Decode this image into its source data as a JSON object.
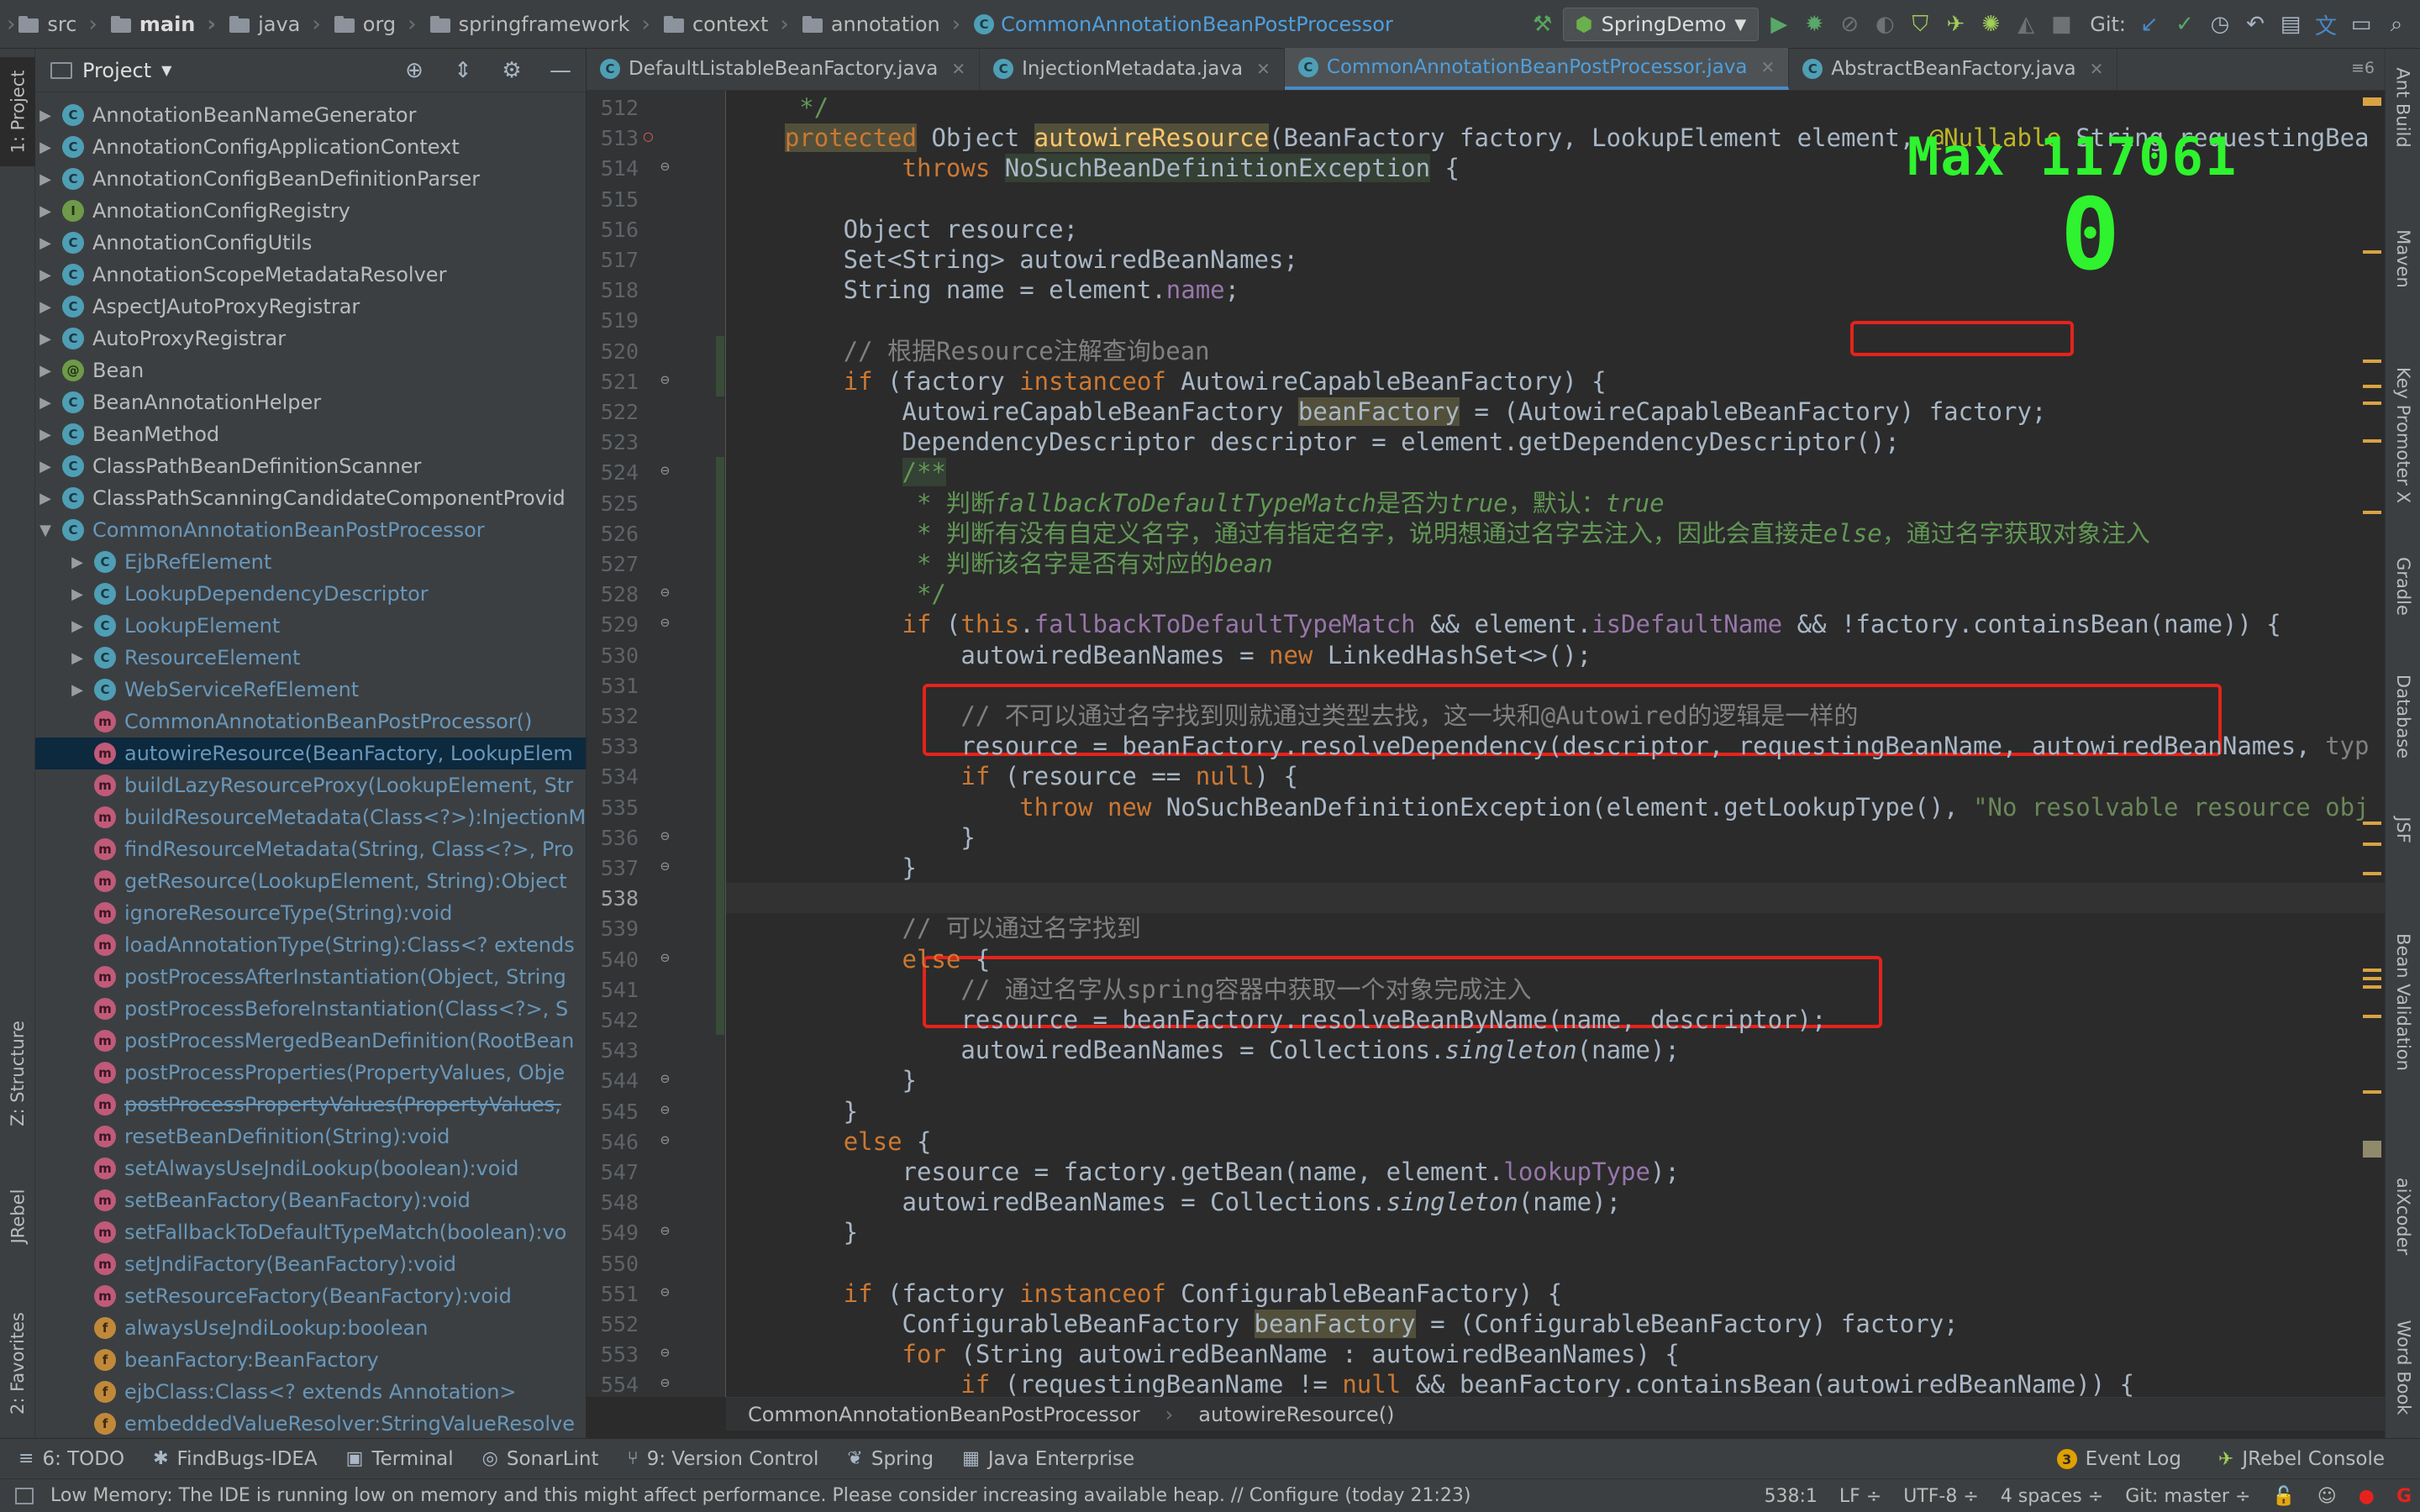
{
  "navbar": {
    "crumbs": [
      {
        "label": "src",
        "icon": "folder-icon"
      },
      {
        "label": "main",
        "icon": "folder-icon",
        "bold": true
      },
      {
        "label": "java",
        "icon": "folder-icon"
      },
      {
        "label": "org",
        "icon": "folder-icon"
      },
      {
        "label": "springframework",
        "icon": "folder-icon"
      },
      {
        "label": "context",
        "icon": "folder-icon"
      },
      {
        "label": "annotation",
        "icon": "folder-icon"
      },
      {
        "label": "CommonAnnotationBeanPostProcessor",
        "icon": "class-icon"
      }
    ],
    "run_config": "SpringDemo",
    "git_label": "Git:"
  },
  "left_stripe": {
    "project_tab": "1: Project",
    "structure_tab": "Z: Structure",
    "jrebel_tab": "JRebel",
    "favorites_tab": "2: Favorites"
  },
  "project_panel": {
    "title": "Project",
    "tree": [
      {
        "label": "AnnotationBeanNameGenerator",
        "icon": "c",
        "depth": 0,
        "arrow": "▶"
      },
      {
        "label": "AnnotationConfigApplicationContext",
        "icon": "c",
        "depth": 0,
        "arrow": "▶"
      },
      {
        "label": "AnnotationConfigBeanDefinitionParser",
        "icon": "c",
        "depth": 0,
        "arrow": "▶"
      },
      {
        "label": "AnnotationConfigRegistry",
        "icon": "i",
        "depth": 0,
        "arrow": "▶"
      },
      {
        "label": "AnnotationConfigUtils",
        "icon": "c",
        "depth": 0,
        "arrow": "▶"
      },
      {
        "label": "AnnotationScopeMetadataResolver",
        "icon": "c",
        "depth": 0,
        "arrow": "▶"
      },
      {
        "label": "AspectJAutoProxyRegistrar",
        "icon": "c",
        "depth": 0,
        "arrow": "▶"
      },
      {
        "label": "AutoProxyRegistrar",
        "icon": "c",
        "depth": 0,
        "arrow": "▶"
      },
      {
        "label": "Bean",
        "icon": "a",
        "depth": 0,
        "arrow": "▶"
      },
      {
        "label": "BeanAnnotationHelper",
        "icon": "c",
        "depth": 0,
        "arrow": "▶"
      },
      {
        "label": "BeanMethod",
        "icon": "c",
        "depth": 0,
        "arrow": "▶"
      },
      {
        "label": "ClassPathBeanDefinitionScanner",
        "icon": "c",
        "depth": 0,
        "arrow": "▶"
      },
      {
        "label": "ClassPathScanningCandidateComponentProvid",
        "icon": "c",
        "depth": 0,
        "arrow": "▶"
      },
      {
        "label": "CommonAnnotationBeanPostProcessor",
        "icon": "c",
        "depth": 0,
        "arrow": "▼",
        "blue": true
      },
      {
        "label": "EjbRefElement",
        "icon": "c",
        "depth": 1,
        "arrow": "▶",
        "blue": true
      },
      {
        "label": "LookupDependencyDescriptor",
        "icon": "c",
        "depth": 1,
        "arrow": "▶",
        "blue": true
      },
      {
        "label": "LookupElement",
        "icon": "c",
        "depth": 1,
        "arrow": "▶",
        "blue": true
      },
      {
        "label": "ResourceElement",
        "icon": "c",
        "depth": 1,
        "arrow": "▶",
        "blue": true
      },
      {
        "label": "WebServiceRefElement",
        "icon": "c",
        "depth": 1,
        "arrow": "▶",
        "blue": true
      },
      {
        "label": "CommonAnnotationBeanPostProcessor()",
        "icon": "m",
        "depth": 1,
        "arrow": "",
        "blue": true
      },
      {
        "label": "autowireResource(BeanFactory, LookupElem",
        "icon": "m",
        "depth": 1,
        "arrow": "",
        "blue": true,
        "selected": true
      },
      {
        "label": "buildLazyResourceProxy(LookupElement, Str",
        "icon": "m",
        "depth": 1,
        "arrow": "",
        "blue": true
      },
      {
        "label": "buildResourceMetadata(Class<?>):InjectionM",
        "icon": "m",
        "depth": 1,
        "arrow": "",
        "blue": true
      },
      {
        "label": "findResourceMetadata(String, Class<?>, Pro",
        "icon": "m",
        "depth": 1,
        "arrow": "",
        "blue": true
      },
      {
        "label": "getResource(LookupElement, String):Object",
        "icon": "m",
        "depth": 1,
        "arrow": "",
        "blue": true
      },
      {
        "label": "ignoreResourceType(String):void",
        "icon": "m",
        "depth": 1,
        "arrow": "",
        "blue": true
      },
      {
        "label": "loadAnnotationType(String):Class<? extends",
        "icon": "m",
        "depth": 1,
        "arrow": "",
        "blue": true
      },
      {
        "label": "postProcessAfterInstantiation(Object, String",
        "icon": "m",
        "depth": 1,
        "arrow": "",
        "blue": true
      },
      {
        "label": "postProcessBeforeInstantiation(Class<?>, S",
        "icon": "m",
        "depth": 1,
        "arrow": "",
        "blue": true
      },
      {
        "label": "postProcessMergedBeanDefinition(RootBean",
        "icon": "m",
        "depth": 1,
        "arrow": "",
        "blue": true
      },
      {
        "label": "postProcessProperties(PropertyValues, Obje",
        "icon": "m",
        "depth": 1,
        "arrow": "",
        "blue": true
      },
      {
        "label": "postProcessPropertyValues(PropertyValues,",
        "icon": "m",
        "depth": 1,
        "arrow": "",
        "blue": true,
        "strike": true
      },
      {
        "label": "resetBeanDefinition(String):void",
        "icon": "m",
        "depth": 1,
        "arrow": "",
        "blue": true
      },
      {
        "label": "setAlwaysUseJndiLookup(boolean):void",
        "icon": "m",
        "depth": 1,
        "arrow": "",
        "blue": true
      },
      {
        "label": "setBeanFactory(BeanFactory):void",
        "icon": "m",
        "depth": 1,
        "arrow": "",
        "blue": true
      },
      {
        "label": "setFallbackToDefaultTypeMatch(boolean):vo",
        "icon": "m",
        "depth": 1,
        "arrow": "",
        "blue": true
      },
      {
        "label": "setJndiFactory(BeanFactory):void",
        "icon": "m",
        "depth": 1,
        "arrow": "",
        "blue": true
      },
      {
        "label": "setResourceFactory(BeanFactory):void",
        "icon": "m",
        "depth": 1,
        "arrow": "",
        "blue": true
      },
      {
        "label": "alwaysUseJndiLookup:boolean",
        "icon": "f",
        "depth": 1,
        "arrow": "",
        "blue": true
      },
      {
        "label": "beanFactory:BeanFactory",
        "icon": "f",
        "depth": 1,
        "arrow": "",
        "blue": true
      },
      {
        "label": "ejbClass:Class<? extends Annotation>",
        "icon": "f",
        "depth": 1,
        "arrow": "",
        "blue": true
      },
      {
        "label": "embeddedValueResolver:StringValueResolve",
        "icon": "f",
        "depth": 1,
        "arrow": "",
        "blue": true
      }
    ]
  },
  "editor": {
    "tabs": [
      {
        "label": "DefaultListableBeanFactory.java",
        "active": false
      },
      {
        "label": "InjectionMetadata.java",
        "active": false
      },
      {
        "label": "CommonAnnotationBeanPostProcessor.java",
        "active": true
      },
      {
        "label": "AbstractBeanFactory.java",
        "active": false
      }
    ],
    "tab_count": "≡6",
    "current_line": "538",
    "lines": [
      {
        "n": "512",
        "html": "<span class=\"docm\">     */</span>"
      },
      {
        "n": "513",
        "html": "    <span class=\"kw hlw\">protected</span> Object <span class=\"fn hlw\">autowireResource</span>(BeanFactory factory, LookupElement element, <span class=\"ann\">@Nullable</span> String requestingBea"
      },
      {
        "n": "514",
        "html": "            <span class=\"kw\">throws</span> <span class=\"hl\">NoSuchBeanDefinitionException</span> {"
      },
      {
        "n": "515",
        "html": ""
      },
      {
        "n": "516",
        "html": "        Object resource;"
      },
      {
        "n": "517",
        "html": "        Set&lt;String&gt; autowiredBeanNames;"
      },
      {
        "n": "518",
        "html": "        String name = element.<span class=\"fld\">name</span>;"
      },
      {
        "n": "519",
        "html": ""
      },
      {
        "n": "520",
        "html": "        <span class=\"cmt\">// 根据Resource注解查询bean</span>"
      },
      {
        "n": "521",
        "html": "        <span class=\"kw\">if</span> (factory <span class=\"kw\">instanceof</span> AutowireCapableBeanFactory) {"
      },
      {
        "n": "522",
        "html": "            AutowireCapableBeanFactory <span class=\"hlw\">beanFactory</span> = (AutowireCapableBeanFactory) factory;"
      },
      {
        "n": "523",
        "html": "            DependencyDescriptor descriptor = element.getDependencyDescriptor();"
      },
      {
        "n": "524",
        "html": "            <span class=\"docm hl\">/**</span>"
      },
      {
        "n": "525",
        "html": "<span class=\"docm\">             * 判断<span class=\"it\">fallbackToDefaultTypeMatch</span>是否为<span class=\"it\">true</span>，默认：<span class=\"it\">true</span></span>"
      },
      {
        "n": "526",
        "html": "<span class=\"docm\">             * 判断有没有自定义名字，通过有指定名字，说明想通过名字去注入，因此会直接走<span class=\"it\">else</span>，通过名字获取对象注入</span>"
      },
      {
        "n": "527",
        "html": "<span class=\"docm\">             * 判断该名字是否有对应的<span class=\"it\">bean</span></span>"
      },
      {
        "n": "528",
        "html": "<span class=\"docm\">             */</span>"
      },
      {
        "n": "529",
        "html": "            <span class=\"kw\">if</span> (<span class=\"kw\">this</span>.<span class=\"fld\">fallbackToDefaultTypeMatch</span> &amp;&amp; element.<span class=\"fld\">isDefaultName</span> &amp;&amp; !factory.containsBean(name)) {"
      },
      {
        "n": "530",
        "html": "                autowiredBeanNames = <span class=\"kw\">new</span> LinkedHashSet&lt;&gt;();"
      },
      {
        "n": "531",
        "html": ""
      },
      {
        "n": "532",
        "html": "                <span class=\"cmt\">// 不可以通过名字找到则就通过类型去找，这一块和@Autowired的逻辑是一样的</span>"
      },
      {
        "n": "533",
        "html": "                resource = beanFactory.resolveDependency(descriptor, requestingBeanName, autowiredBeanNames, <span class=\"cmt\">typ</span>"
      },
      {
        "n": "534",
        "html": "                <span class=\"kw\">if</span> (resource == <span class=\"kw\">null</span>) {"
      },
      {
        "n": "535",
        "html": "                    <span class=\"kw\">throw new</span> NoSuchBeanDefinitionException(element.getLookupType(), <span class=\"str\">\"No resolvable resource obj</span>"
      },
      {
        "n": "536",
        "html": "                }"
      },
      {
        "n": "537",
        "html": "            }"
      },
      {
        "n": "538",
        "html": "",
        "current": true
      },
      {
        "n": "539",
        "html": "            <span class=\"cmt\">// 可以通过名字找到</span>"
      },
      {
        "n": "540",
        "html": "            <span class=\"kw\">else</span> {"
      },
      {
        "n": "541",
        "html": "                <span class=\"cmt\">// 通过名字从spring容器中获取一个对象完成注入</span>"
      },
      {
        "n": "542",
        "html": "                resource = beanFactory.resolveBeanByName(name, descriptor);"
      },
      {
        "n": "543",
        "html": "                autowiredBeanNames = Collections.<span class=\"it\">singleton</span>(name);"
      },
      {
        "n": "544",
        "html": "            }"
      },
      {
        "n": "545",
        "html": "        }"
      },
      {
        "n": "546",
        "html": "        <span class=\"kw\">else</span> {"
      },
      {
        "n": "547",
        "html": "            resource = factory.getBean(name, element.<span class=\"fld\">lookupType</span>);"
      },
      {
        "n": "548",
        "html": "            autowiredBeanNames = Collections.<span class=\"it\">singleton</span>(name);"
      },
      {
        "n": "549",
        "html": "        }"
      },
      {
        "n": "550",
        "html": ""
      },
      {
        "n": "551",
        "html": "        <span class=\"kw\">if</span> (factory <span class=\"kw\">instanceof</span> ConfigurableBeanFactory) {"
      },
      {
        "n": "552",
        "html": "            ConfigurableBeanFactory <span class=\"hlw\">beanFactory</span> = (ConfigurableBeanFactory) factory;"
      },
      {
        "n": "553",
        "html": "            <span class=\"kw\">for</span> (String autowiredBeanName : autowiredBeanNames) {"
      },
      {
        "n": "554",
        "html": "                <span class=\"kw\">if</span> (requestingBeanName != <span class=\"kw\">null</span> &amp;&amp; beanFactory.containsBean(autowiredBeanName)) {"
      }
    ],
    "hud": {
      "max_label": "Max 117061",
      "combo": "0"
    },
    "breadcrumb": [
      "CommonAnnotationBeanPostProcessor",
      "autowireResource()"
    ]
  },
  "right_stripe": [
    "Ant Build",
    "Maven",
    "Key Promoter X",
    "Gradle",
    "Database",
    "JSF",
    "Bean Validation",
    "aiXcoder",
    "Word Book"
  ],
  "bottom_tools": [
    {
      "label": "6: TODO",
      "icon": "≡"
    },
    {
      "label": "FindBugs-IDEA",
      "icon": "✱"
    },
    {
      "label": "Terminal",
      "icon": "▣"
    },
    {
      "label": "SonarLint",
      "icon": "◎"
    },
    {
      "label": "9: Version Control",
      "icon": "⑂"
    },
    {
      "label": "Spring",
      "icon": "❦"
    },
    {
      "label": "Java Enterprise",
      "icon": "▦"
    }
  ],
  "bottom_right_tools": [
    {
      "label": "Event Log",
      "badge": "3"
    },
    {
      "label": "JRebel Console",
      "badge": ""
    }
  ],
  "status": {
    "message": "Low Memory: The IDE is running low on memory and this might affect performance. Please consider increasing available heap. // Configure (today 21:23)",
    "position": "538:1",
    "line_sep": "LF ÷",
    "encoding": "UTF-8 ÷",
    "indent": "4 spaces ÷",
    "git_branch": "Git: master ÷"
  },
  "colors": {
    "accent": "#4a88c7",
    "annotation_box": "#e5231c",
    "hud": "#2ef32e",
    "selection": "#0d293e"
  }
}
